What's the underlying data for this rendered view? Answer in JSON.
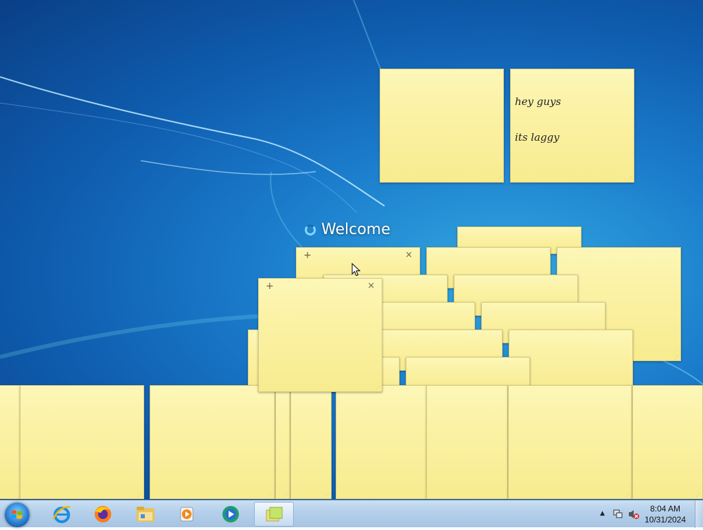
{
  "desktop": {
    "welcome_text": "Welcome"
  },
  "notes": {
    "text_note": {
      "line1": "hey guys",
      "line2": "its laggy"
    },
    "new_note_glyph": "+",
    "close_glyph": "×",
    "color": "#fbf2a6"
  },
  "taskbar": {
    "start": "start-orb",
    "pinned": [
      {
        "name": "internet-explorer-icon"
      },
      {
        "name": "firefox-icon"
      },
      {
        "name": "file-explorer-icon"
      },
      {
        "name": "media-player-icon"
      },
      {
        "name": "windows-live-icon"
      },
      {
        "name": "sticky-notes-icon",
        "active": true
      }
    ],
    "tray": {
      "expand_glyph": "▲",
      "icons": [
        "network-icon",
        "volume-muted-icon"
      ]
    },
    "clock": {
      "time": "8:04 AM",
      "date": "10/31/2024"
    }
  }
}
